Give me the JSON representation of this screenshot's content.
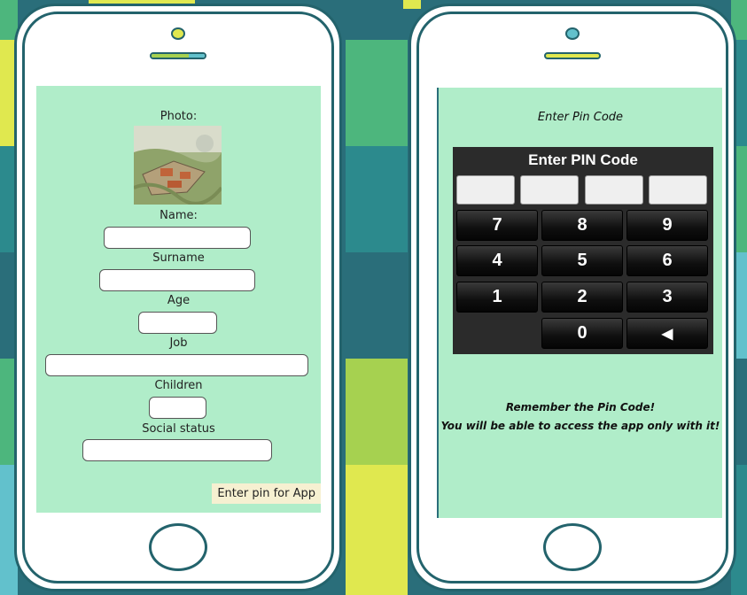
{
  "colors": {
    "background_dark": "#2a6e7a",
    "tile_green": "#4db67d",
    "tile_lime": "#e0e84f",
    "tile_olive": "#a6d150",
    "tile_teal": "#2c8a8d",
    "tile_blue": "#62c1cc",
    "phone_outline": "#23636c",
    "screen_bg": "#b0edc9",
    "keypad_bg": "#2b2b2b",
    "pin_link_bg": "#f6f0d1"
  },
  "profile_form": {
    "photo_label": "Photo:",
    "name_label": "Name:",
    "surname_label": "Surname",
    "age_label": "Age",
    "job_label": "Job",
    "children_label": "Children",
    "social_status_label": "Social status",
    "name_value": "",
    "surname_value": "",
    "age_value": "",
    "job_value": "",
    "children_value": "",
    "social_status_value": "",
    "enter_pin_button": "Enter pin for App"
  },
  "pin_screen": {
    "heading": "Enter Pin Code",
    "keypad_title": "Enter PIN Code",
    "keys": [
      "7",
      "8",
      "9",
      "4",
      "5",
      "6",
      "1",
      "2",
      "3",
      "0",
      "◀"
    ],
    "remember_line1": "Remember the Pin Code!",
    "remember_line2": "You will be able to access the app only with it!"
  }
}
